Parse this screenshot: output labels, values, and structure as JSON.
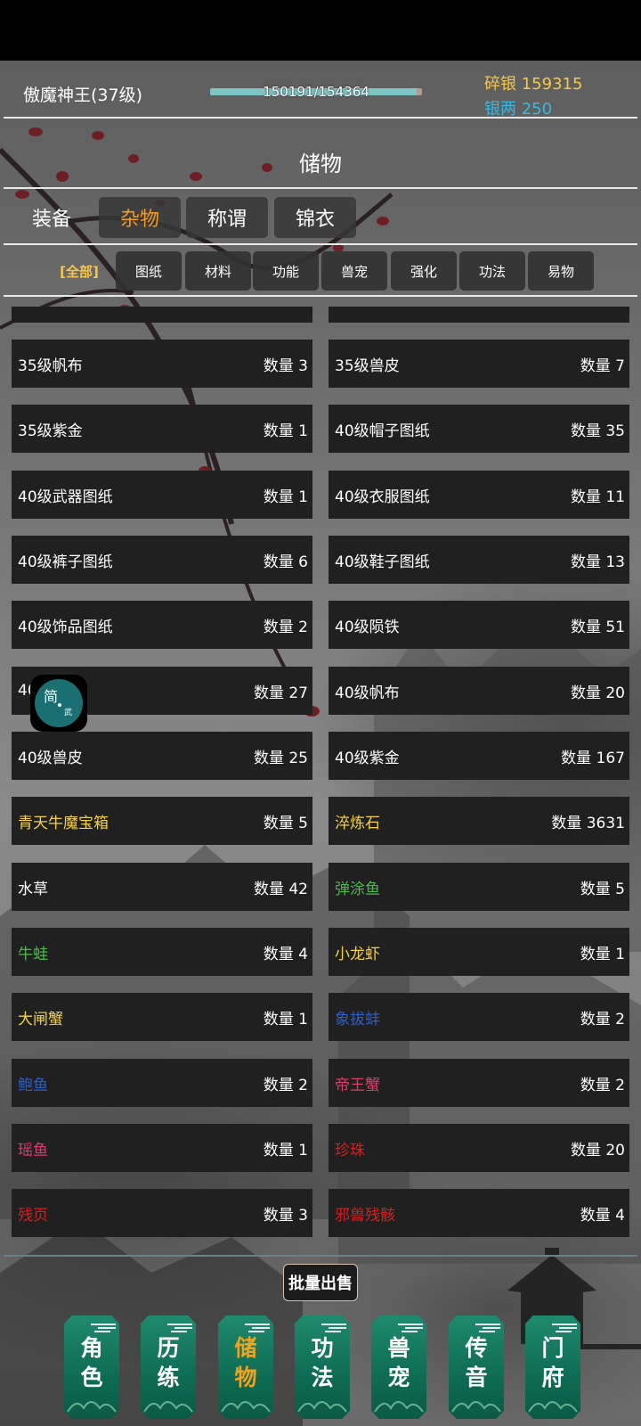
{
  "header": {
    "player_name": "傲魔神王(37级)",
    "exp_text": "150191/154364",
    "exp_progress": 0.973,
    "money": [
      {
        "label": "碎银",
        "value": "159315"
      },
      {
        "label": "银两",
        "value": "250"
      }
    ]
  },
  "page_title": "储物",
  "main_tabs": [
    {
      "label": "装备",
      "active": false
    },
    {
      "label": "杂物",
      "active": true
    },
    {
      "label": "称谓",
      "active": false
    },
    {
      "label": "锦衣",
      "active": false
    }
  ],
  "sub_tabs": [
    {
      "label": "[全部]",
      "active": true
    },
    {
      "label": "图纸",
      "active": false
    },
    {
      "label": "材料",
      "active": false
    },
    {
      "label": "功能",
      "active": false
    },
    {
      "label": "兽宠",
      "active": false
    },
    {
      "label": "强化",
      "active": false
    },
    {
      "label": "功法",
      "active": false
    },
    {
      "label": "易物",
      "active": false
    }
  ],
  "items": [
    {
      "name": "35级帆布",
      "qty": "数量 3",
      "color": "white"
    },
    {
      "name": "35级兽皮",
      "qty": "数量 7",
      "color": "white"
    },
    {
      "name": "35级紫金",
      "qty": "数量 1",
      "color": "white"
    },
    {
      "name": "40级帽子图纸",
      "qty": "数量 35",
      "color": "white"
    },
    {
      "name": "40级武器图纸",
      "qty": "数量 1",
      "color": "white"
    },
    {
      "name": "40级衣服图纸",
      "qty": "数量 11",
      "color": "white"
    },
    {
      "name": "40级裤子图纸",
      "qty": "数量 6",
      "color": "white"
    },
    {
      "name": "40级鞋子图纸",
      "qty": "数量 13",
      "color": "white"
    },
    {
      "name": "40级饰品图纸",
      "qty": "数量 2",
      "color": "white"
    },
    {
      "name": "40级陨铁",
      "qty": "数量 51",
      "color": "white"
    },
    {
      "name": "40",
      "qty": "数量 27",
      "color": "white"
    },
    {
      "name": "40级帆布",
      "qty": "数量 20",
      "color": "white"
    },
    {
      "name": "40级兽皮",
      "qty": "数量 25",
      "color": "white"
    },
    {
      "name": "40级紫金",
      "qty": "数量 167",
      "color": "white"
    },
    {
      "name": "青天牛魔宝箱",
      "qty": "数量 5",
      "color": "yellow"
    },
    {
      "name": "淬炼石",
      "qty": "数量 3631",
      "color": "yellow"
    },
    {
      "name": "水草",
      "qty": "数量 42",
      "color": "white"
    },
    {
      "name": "弹涂鱼",
      "qty": "数量 5",
      "color": "green"
    },
    {
      "name": "牛蛙",
      "qty": "数量 4",
      "color": "green"
    },
    {
      "name": "小龙虾",
      "qty": "数量 1",
      "color": "yellow"
    },
    {
      "name": "大闸蟹",
      "qty": "数量 1",
      "color": "yellow"
    },
    {
      "name": "象拔蚌",
      "qty": "数量 2",
      "color": "blue"
    },
    {
      "name": "鲍鱼",
      "qty": "数量 2",
      "color": "blue"
    },
    {
      "name": "帝王蟹",
      "qty": "数量 2",
      "color": "pink"
    },
    {
      "name": "瑶鱼",
      "qty": "数量 1",
      "color": "pink"
    },
    {
      "name": "珍珠",
      "qty": "数量 20",
      "color": "red"
    },
    {
      "name": "残页",
      "qty": "数量 3",
      "color": "red"
    },
    {
      "name": "邪兽残骸",
      "qty": "数量 4",
      "color": "red"
    }
  ],
  "float_button": {
    "char_main": "简",
    "char_sub": "武"
  },
  "batch_sell_label": "批量出售",
  "bottom_nav": [
    {
      "chars": [
        "角",
        "色"
      ],
      "active": false
    },
    {
      "chars": [
        "历",
        "练"
      ],
      "active": false
    },
    {
      "chars": [
        "储",
        "物"
      ],
      "active": true
    },
    {
      "chars": [
        "功",
        "法"
      ],
      "active": false
    },
    {
      "chars": [
        "兽",
        "宠"
      ],
      "active": false
    },
    {
      "chars": [
        "传",
        "音"
      ],
      "active": false
    },
    {
      "chars": [
        "门",
        "府"
      ],
      "active": false
    }
  ],
  "colors": {
    "white": "#ffffff",
    "yellow": "#f5d23c",
    "green": "#4cb84c",
    "blue": "#2e5fc4",
    "pink": "#e13c6e",
    "red": "#d81e1e",
    "accent_orange": "#f59a1b",
    "gold": "#f5c84a",
    "silver_blue": "#37b9e6"
  }
}
